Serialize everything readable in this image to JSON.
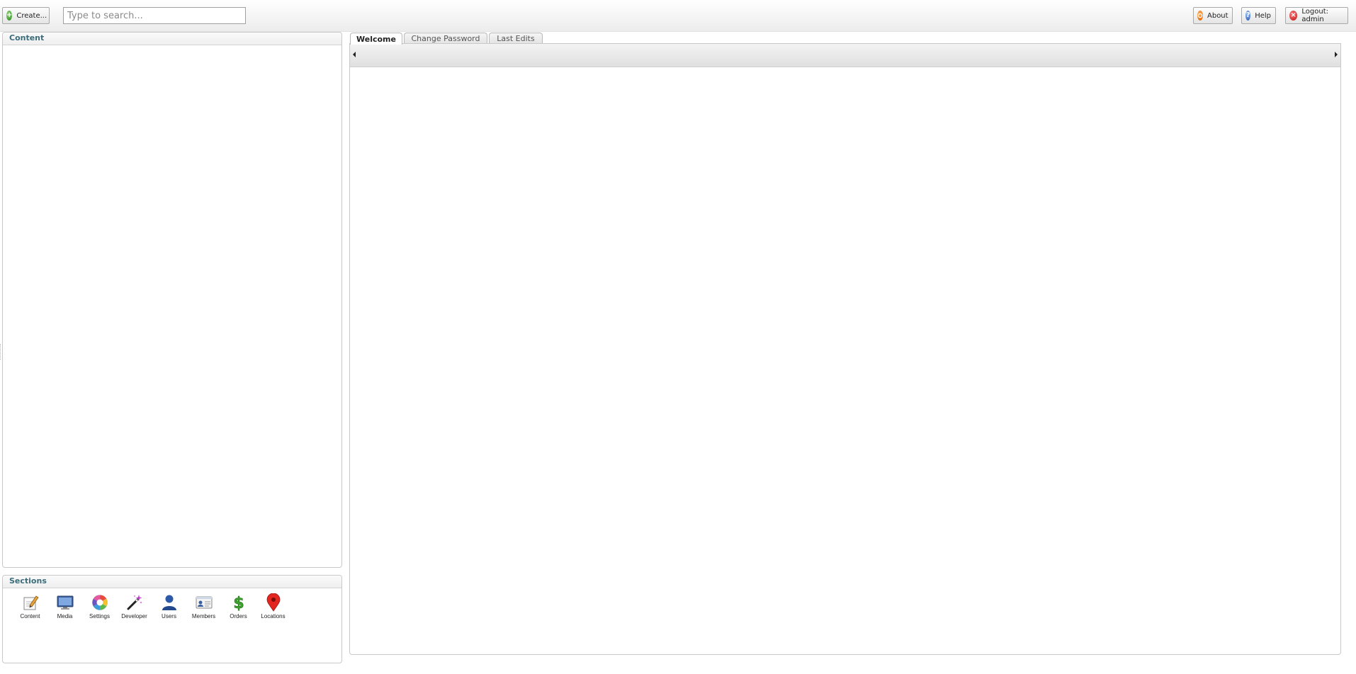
{
  "toolbar": {
    "create_label": "Create...",
    "search_placeholder": "Type to search...",
    "about_label": "About",
    "help_label": "Help",
    "logout_label": "Logout: admin"
  },
  "tree_panel": {
    "title": "Content"
  },
  "sections_panel": {
    "title": "Sections",
    "items": [
      {
        "label": "Content",
        "icon": "content-pencil-icon"
      },
      {
        "label": "Media",
        "icon": "media-monitor-icon"
      },
      {
        "label": "Settings",
        "icon": "settings-colorwheel-icon"
      },
      {
        "label": "Developer",
        "icon": "developer-wand-icon"
      },
      {
        "label": "Users",
        "icon": "users-person-icon"
      },
      {
        "label": "Members",
        "icon": "members-card-icon"
      },
      {
        "label": "Orders",
        "icon": "orders-dollar-icon"
      },
      {
        "label": "Locations",
        "icon": "locations-pin-icon"
      }
    ]
  },
  "tabs": [
    {
      "label": "Welcome",
      "active": true
    },
    {
      "label": "Change Password",
      "active": false
    },
    {
      "label": "Last Edits",
      "active": false
    }
  ],
  "colors": {
    "panel_title": "#3a6c79",
    "border": "#c9c9c9"
  }
}
